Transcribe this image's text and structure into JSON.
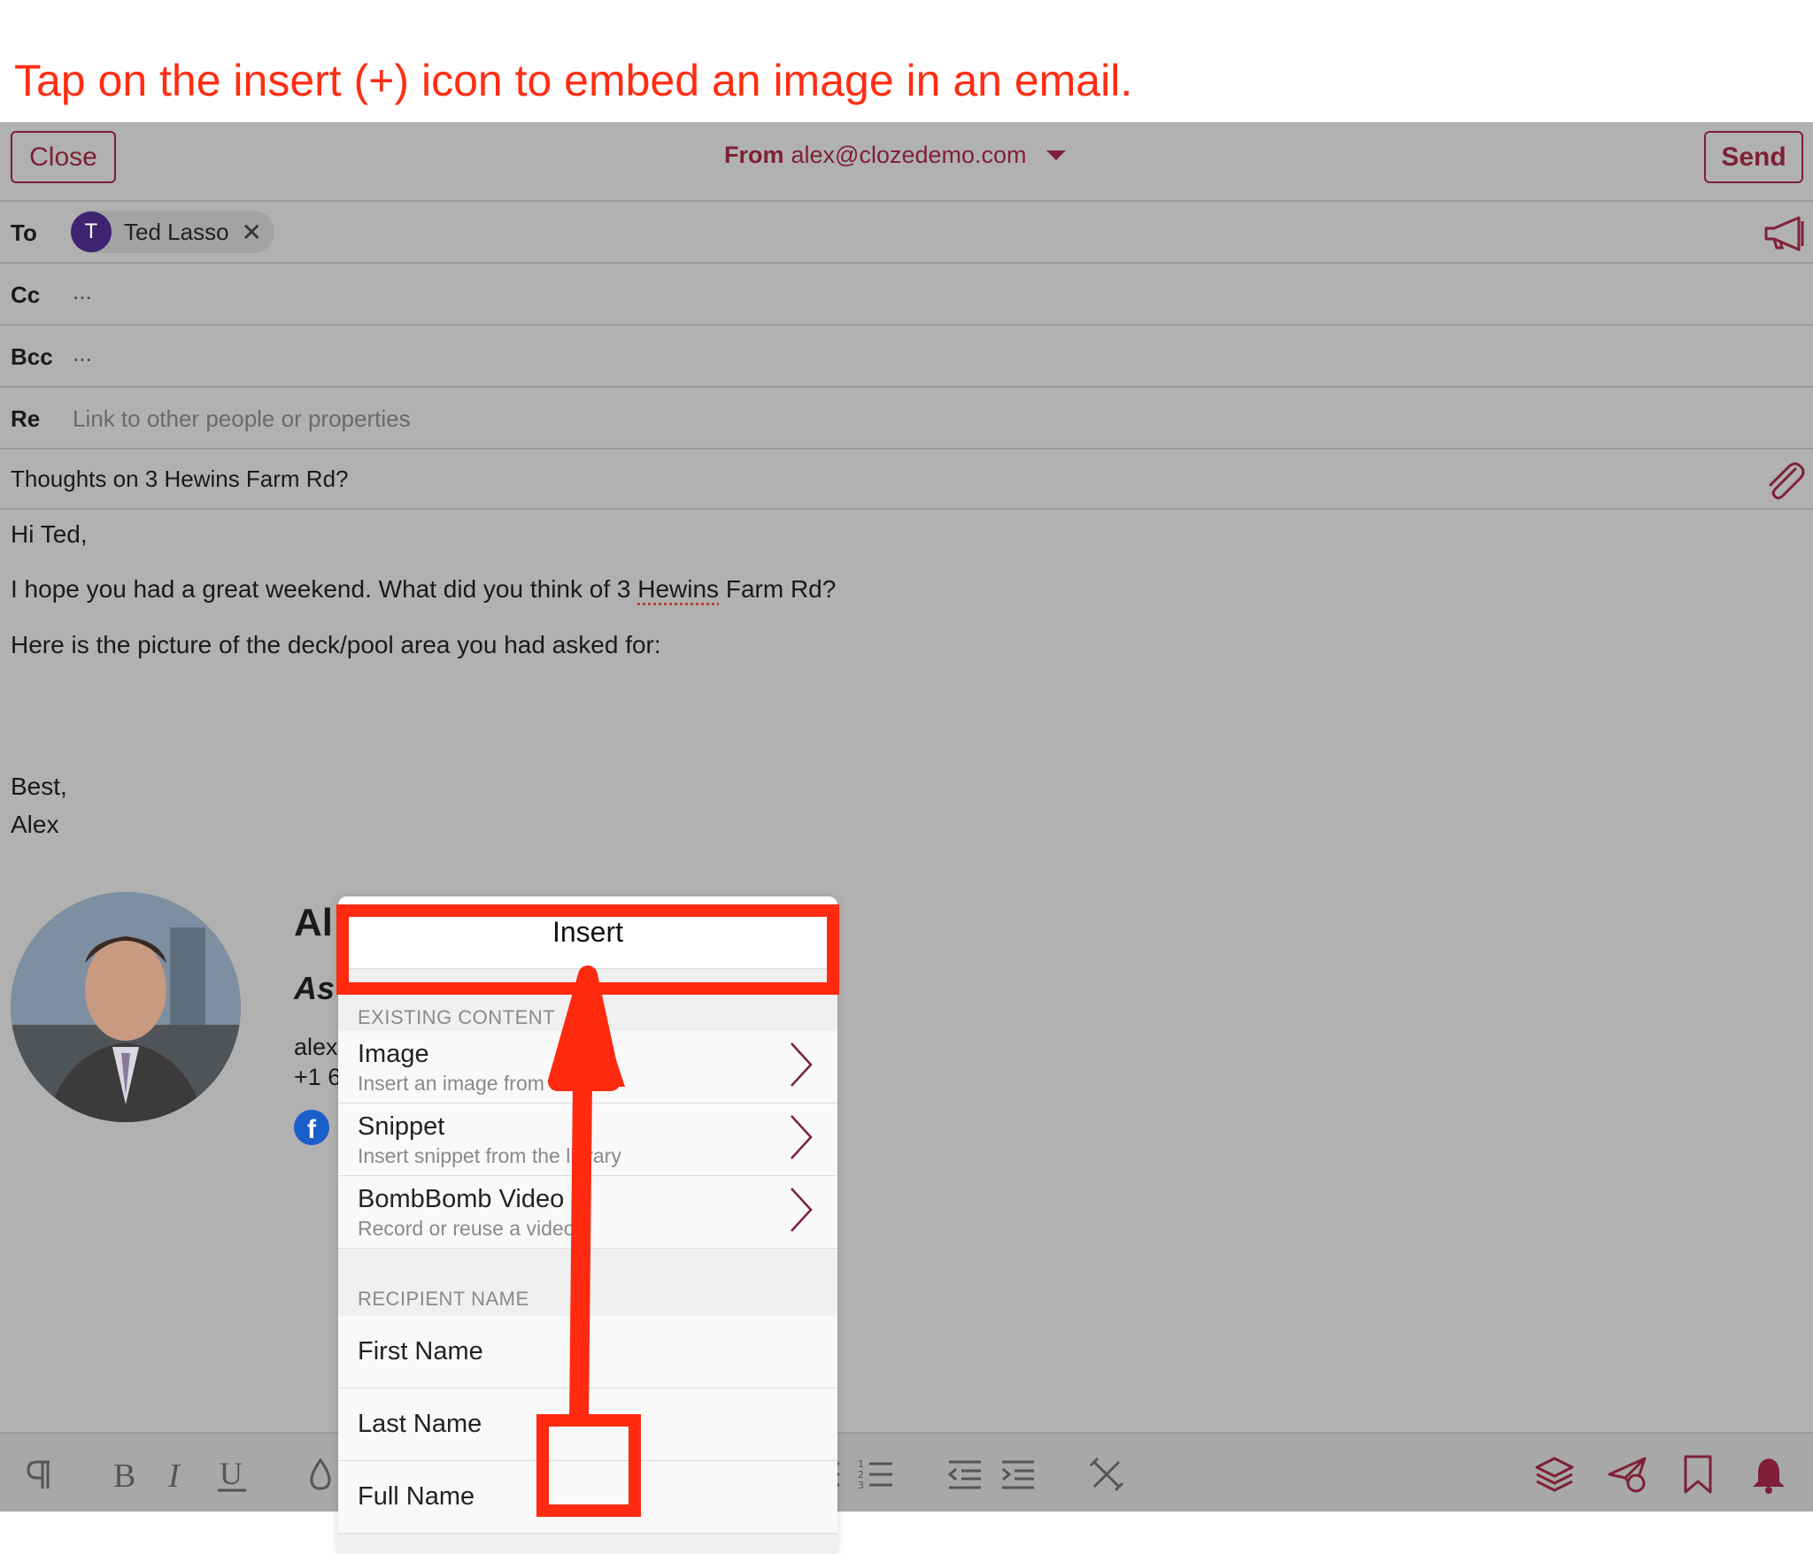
{
  "caption": "Tap on the insert (+) icon to embed an image in an email.",
  "header": {
    "close_label": "Close",
    "send_label": "Send",
    "from_label": "From",
    "from_email": "alex@clozedemo.com"
  },
  "fields": {
    "to_label": "To",
    "to_recipient_initial": "T",
    "to_recipient_name": "Ted Lasso",
    "remove_symbol": "✕",
    "cc_label": "Cc",
    "cc_value": "...",
    "bcc_label": "Bcc",
    "bcc_value": "...",
    "re_label": "Re",
    "re_placeholder": "Link to other people or properties",
    "subject": "Thoughts on 3 Hewins Farm Rd?"
  },
  "body": {
    "greeting": "Hi Ted,",
    "line1_before": "I hope you had a great weekend. What did you think of 3 ",
    "line1_misspelled": "Hewins",
    "line1_after": " Farm Rd?",
    "line2": "Here is the picture of the deck/pool area you had asked for:",
    "closing": "Best,",
    "signoff": "Alex"
  },
  "signature": {
    "name_visible": "Al",
    "title_visible": "As",
    "email_visible": "alex",
    "phone_visible": "+1 6"
  },
  "insert_popover": {
    "title": "Insert",
    "section_existing": "EXISTING CONTENT",
    "items": [
      {
        "title": "Image",
        "subtitle": "Insert an image from a file"
      },
      {
        "title": "Snippet",
        "subtitle": "Insert snippet from the library"
      },
      {
        "title": "BombBomb Video",
        "subtitle": "Record or reuse a video"
      }
    ],
    "section_recipient": "RECIPIENT NAME",
    "name_items": [
      "First Name",
      "Last Name",
      "Full Name"
    ]
  },
  "toolbar": {
    "icons": [
      "paragraph-icon",
      "bold-icon",
      "italic-icon",
      "underline-icon",
      "text-color-icon",
      "font-size-icon",
      "font-icon",
      "clear-format-icon",
      "insert-plus-icon",
      "link-icon",
      "unlink-icon",
      "bullet-list-icon",
      "numbered-list-icon",
      "outdent-icon",
      "indent-icon",
      "tools-icon",
      "templates-icon",
      "schedule-send-icon",
      "bookmark-icon",
      "reminder-bell-icon"
    ]
  },
  "colors": {
    "accent": "#7f2038",
    "annotation": "#ff2a10",
    "background": "#b1b1b1",
    "avatar": "#3d2370"
  }
}
